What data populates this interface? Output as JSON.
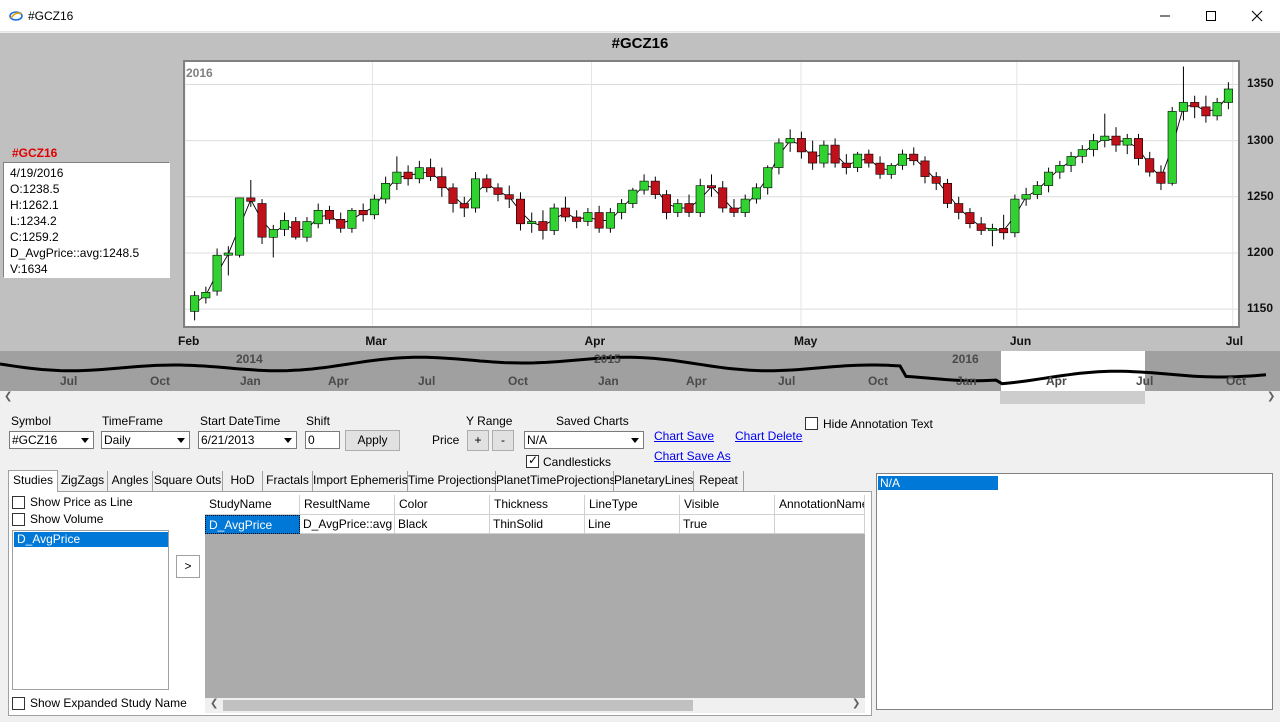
{
  "window": {
    "title": "#GCZ16"
  },
  "chart": {
    "title": "#GCZ16",
    "year_badge": "2016",
    "info": {
      "symbol": "#GCZ16",
      "lines": [
        "4/19/2016",
        "O:1238.5",
        "H:1262.1",
        "L:1234.2",
        "C:1259.2",
        "D_AvgPrice::avg:1248.5",
        "V:1634"
      ]
    }
  },
  "chart_data": {
    "type": "candlestick",
    "title": "#GCZ16",
    "x_tick_labels": [
      "Feb",
      "Mar",
      "Apr",
      "May",
      "Jun",
      "Jul"
    ],
    "y_tick_labels": [
      "1150",
      "1200",
      "1250",
      "1300",
      "1350"
    ],
    "ylim": [
      1135,
      1370
    ],
    "grid": true,
    "colors": {
      "up": "#2fd22f",
      "down": "#c0101a",
      "avg_line": "#000000"
    },
    "series": [
      {
        "name": "D_AvgPrice::avg",
        "ohlc": [
          [
            1148,
            1166,
            1140,
            1162
          ],
          [
            1160,
            1170,
            1155,
            1165
          ],
          [
            1166,
            1204,
            1162,
            1198
          ],
          [
            1198,
            1206,
            1180,
            1200
          ],
          [
            1198,
            1236,
            1196,
            1249
          ],
          [
            1249,
            1265,
            1241,
            1246
          ],
          [
            1244,
            1248,
            1208,
            1214
          ],
          [
            1214,
            1225,
            1196,
            1221
          ],
          [
            1221,
            1236,
            1215,
            1229
          ],
          [
            1228,
            1232,
            1212,
            1214
          ],
          [
            1214,
            1232,
            1210,
            1228
          ],
          [
            1226,
            1244,
            1222,
            1238
          ],
          [
            1238,
            1242,
            1226,
            1230
          ],
          [
            1230,
            1236,
            1218,
            1222
          ],
          [
            1222,
            1240,
            1218,
            1238
          ],
          [
            1238,
            1244,
            1228,
            1234
          ],
          [
            1234,
            1252,
            1230,
            1248
          ],
          [
            1248,
            1268,
            1244,
            1262
          ],
          [
            1262,
            1286,
            1256,
            1272
          ],
          [
            1272,
            1278,
            1260,
            1266
          ],
          [
            1266,
            1282,
            1262,
            1276
          ],
          [
            1276,
            1284,
            1264,
            1268
          ],
          [
            1268,
            1276,
            1250,
            1258
          ],
          [
            1258,
            1262,
            1236,
            1244
          ],
          [
            1244,
            1250,
            1232,
            1240
          ],
          [
            1240,
            1272,
            1236,
            1266
          ],
          [
            1266,
            1270,
            1254,
            1258
          ],
          [
            1258,
            1262,
            1246,
            1252
          ],
          [
            1252,
            1260,
            1240,
            1248
          ],
          [
            1248,
            1254,
            1220,
            1226
          ],
          [
            1226,
            1236,
            1218,
            1228
          ],
          [
            1228,
            1238,
            1212,
            1220
          ],
          [
            1220,
            1244,
            1216,
            1240
          ],
          [
            1240,
            1250,
            1228,
            1232
          ],
          [
            1232,
            1238,
            1222,
            1228
          ],
          [
            1228,
            1240,
            1224,
            1236
          ],
          [
            1236,
            1242,
            1218,
            1222
          ],
          [
            1222,
            1240,
            1218,
            1236
          ],
          [
            1236,
            1248,
            1230,
            1244
          ],
          [
            1244,
            1258,
            1240,
            1256
          ],
          [
            1256,
            1270,
            1252,
            1264
          ],
          [
            1264,
            1268,
            1248,
            1252
          ],
          [
            1252,
            1256,
            1230,
            1236
          ],
          [
            1236,
            1248,
            1232,
            1244
          ],
          [
            1244,
            1252,
            1232,
            1236
          ],
          [
            1236,
            1266,
            1232,
            1260
          ],
          [
            1260,
            1270,
            1250,
            1258
          ],
          [
            1258,
            1264,
            1236,
            1240
          ],
          [
            1240,
            1248,
            1232,
            1236
          ],
          [
            1236,
            1252,
            1232,
            1248
          ],
          [
            1248,
            1262,
            1244,
            1258
          ],
          [
            1258,
            1278,
            1252,
            1276
          ],
          [
            1276,
            1302,
            1270,
            1298
          ],
          [
            1298,
            1310,
            1290,
            1302
          ],
          [
            1302,
            1308,
            1284,
            1290
          ],
          [
            1290,
            1300,
            1274,
            1280
          ],
          [
            1280,
            1300,
            1276,
            1296
          ],
          [
            1296,
            1302,
            1276,
            1280
          ],
          [
            1280,
            1288,
            1270,
            1276
          ],
          [
            1276,
            1290,
            1272,
            1288
          ],
          [
            1288,
            1292,
            1276,
            1280
          ],
          [
            1280,
            1286,
            1266,
            1270
          ],
          [
            1270,
            1280,
            1266,
            1278
          ],
          [
            1278,
            1292,
            1274,
            1288
          ],
          [
            1288,
            1294,
            1278,
            1282
          ],
          [
            1282,
            1286,
            1262,
            1268
          ],
          [
            1268,
            1272,
            1256,
            1262
          ],
          [
            1262,
            1266,
            1240,
            1244
          ],
          [
            1244,
            1250,
            1230,
            1236
          ],
          [
            1236,
            1240,
            1222,
            1226
          ],
          [
            1226,
            1232,
            1216,
            1220
          ],
          [
            1220,
            1226,
            1206,
            1222
          ],
          [
            1222,
            1234,
            1212,
            1218
          ],
          [
            1218,
            1252,
            1214,
            1248
          ],
          [
            1248,
            1258,
            1242,
            1252
          ],
          [
            1252,
            1264,
            1248,
            1260
          ],
          [
            1260,
            1276,
            1254,
            1272
          ],
          [
            1272,
            1282,
            1266,
            1278
          ],
          [
            1278,
            1290,
            1272,
            1286
          ],
          [
            1286,
            1296,
            1280,
            1292
          ],
          [
            1292,
            1306,
            1286,
            1300
          ],
          [
            1300,
            1324,
            1294,
            1304
          ],
          [
            1304,
            1312,
            1290,
            1296
          ],
          [
            1296,
            1306,
            1288,
            1302
          ],
          [
            1302,
            1306,
            1278,
            1284
          ],
          [
            1284,
            1290,
            1268,
            1272
          ],
          [
            1272,
            1278,
            1256,
            1262
          ],
          [
            1262,
            1330,
            1260,
            1326
          ],
          [
            1326,
            1366,
            1318,
            1334
          ],
          [
            1334,
            1340,
            1320,
            1330
          ],
          [
            1330,
            1340,
            1316,
            1322
          ],
          [
            1322,
            1338,
            1318,
            1334
          ],
          [
            1334,
            1352,
            1328,
            1346
          ]
        ]
      }
    ]
  },
  "overview": {
    "labels": [
      "Jul",
      "Oct",
      "Jan",
      "Apr",
      "Jul",
      "Oct",
      "Jan",
      "Apr",
      "Jul",
      "Oct",
      "Jan",
      "Apr",
      "Jul",
      "Oct"
    ],
    "years": [
      "2014",
      "2015",
      "2016"
    ]
  },
  "controls": {
    "symbol_label": "Symbol",
    "symbol_value": "#GCZ16",
    "timeframe_label": "TimeFrame",
    "timeframe_value": "Daily",
    "start_label": "Start DateTime",
    "start_value": "6/21/2013",
    "shift_label": "Shift",
    "shift_value": "0",
    "apply_label": "Apply",
    "price_label": "Price",
    "yrange_label": "Y Range",
    "plus_label": "+",
    "minus_label": "-",
    "saved_charts_label": "Saved Charts",
    "saved_charts_value": "N/A",
    "candlesticks_label": "Candlesticks",
    "chart_save": "Chart Save",
    "chart_delete": "Chart Delete",
    "chart_save_as": "Chart Save As",
    "hide_annotation": "Hide Annotation Text"
  },
  "tabs": [
    "Studies",
    "ZigZags",
    "Angles",
    "Square Outs",
    "HoD",
    "Fractals",
    "Import Ephemeris",
    "Time Projections",
    "PlanetTimeProjections",
    "PlanetaryLines",
    "Repeat"
  ],
  "studies": {
    "show_price_as_line": "Show Price as Line",
    "show_volume": "Show Volume",
    "list": [
      "D_AvgPrice"
    ],
    "move_button": ">",
    "show_expanded": "Show Expanded Study Name",
    "columns": [
      "StudyName",
      "ResultName",
      "Color",
      "Thickness",
      "LineType",
      "Visible",
      "AnnotationName"
    ],
    "rows": [
      [
        "D_AvgPrice",
        "D_AvgPrice::avg",
        "Black",
        "ThinSolid",
        "Line",
        "True",
        ""
      ]
    ]
  },
  "annotations": {
    "items": [
      "N/A"
    ]
  }
}
